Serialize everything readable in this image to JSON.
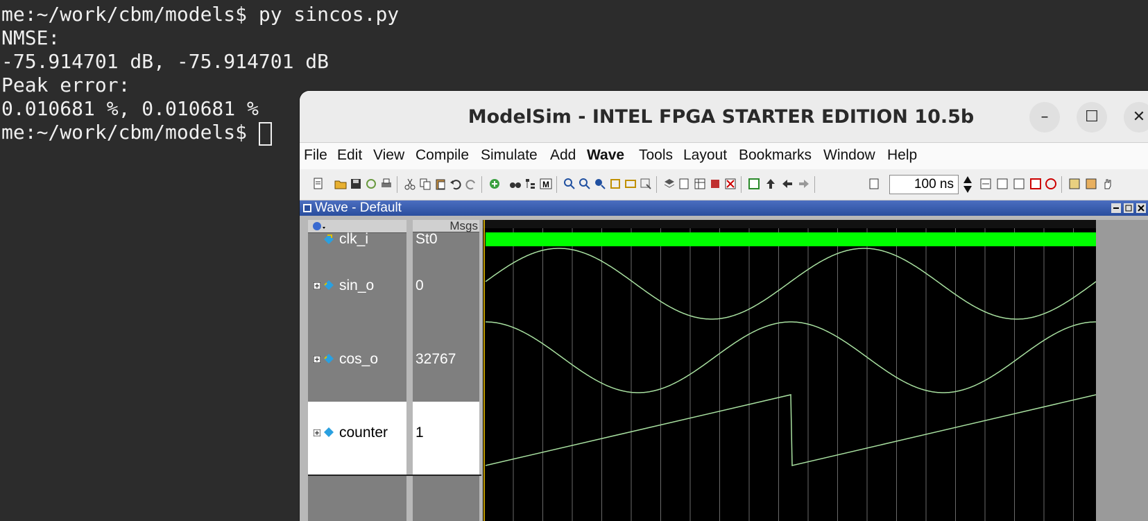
{
  "terminal": {
    "lines": [
      "me:~/work/cbm/models$ py sincos.py",
      "NMSE:",
      "-75.914701 dB, -75.914701 dB",
      "Peak error:",
      "0.010681 %, 0.010681 %",
      "me:~/work/cbm/models$ "
    ]
  },
  "window": {
    "title": "ModelSim - INTEL FPGA STARTER EDITION 10.5b",
    "minimize_glyph": "–",
    "maximize_glyph": "☐",
    "close_glyph": "✕"
  },
  "menu": [
    "File",
    "Edit",
    "View",
    "Compile",
    "Simulate",
    "Add",
    "Wave",
    "Tools",
    "Layout",
    "Bookmarks",
    "Window",
    "Help"
  ],
  "toolbar": {
    "time_value": "100 ns"
  },
  "wave": {
    "pane_title": "Wave - Default",
    "msgs_header": "Msgs",
    "signals": [
      {
        "name": "clk_i",
        "value": "St0",
        "icon": "signal-icon",
        "expandable": false
      },
      {
        "name": "sin_o",
        "value": "0",
        "icon": "bus-icon",
        "expandable": true
      },
      {
        "name": "cos_o",
        "value": "32767",
        "icon": "bus-icon",
        "expandable": true
      },
      {
        "name": "counter",
        "value": "1",
        "icon": "bus-icon",
        "expandable": true
      }
    ]
  },
  "colors": {
    "terminal_bg": "#2c2c2c",
    "clock_bar": "#00ff00",
    "waveform": "#a8e0a0",
    "cursor": "#ffd000",
    "wave_bg": "#000000"
  }
}
